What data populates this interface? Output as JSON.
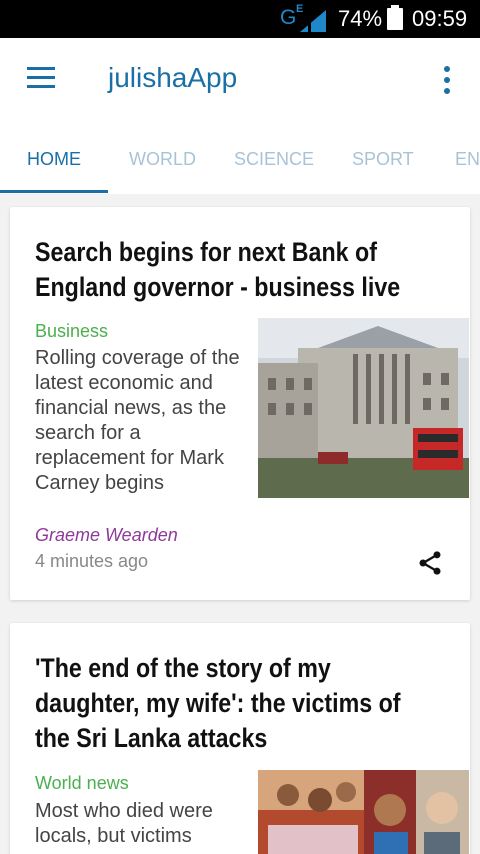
{
  "status_bar": {
    "network": "G",
    "network_sub": "E",
    "battery_percent": "74%",
    "time": "09:59"
  },
  "app_bar": {
    "title": "julishaApp",
    "menu_icon": "hamburger-menu-icon",
    "overflow_icon": "more-vert-icon"
  },
  "tabs": [
    {
      "label": "HOME",
      "active": true
    },
    {
      "label": "WORLD",
      "active": false
    },
    {
      "label": "SCIENCE",
      "active": false
    },
    {
      "label": "SPORT",
      "active": false
    },
    {
      "label": "EN",
      "active": false
    }
  ],
  "colors": {
    "primary": "#1a6fa4",
    "section": "#4caf50",
    "author": "#8e3a9a"
  },
  "articles": [
    {
      "headline": "Search begins for next Bank of England governor - business live",
      "section": "Business",
      "summary": "Rolling coverage of the latest economic and financial news, as the search for a replacement for Mark Carney begins",
      "author": "Graeme Wearden",
      "time": "4 minutes ago",
      "share_icon": "share-icon"
    },
    {
      "headline": "'The end of the story of my daughter, my wife': the victims of the Sri Lanka attacks",
      "section": "World news",
      "summary": "Most who died were locals, but victims"
    }
  ]
}
